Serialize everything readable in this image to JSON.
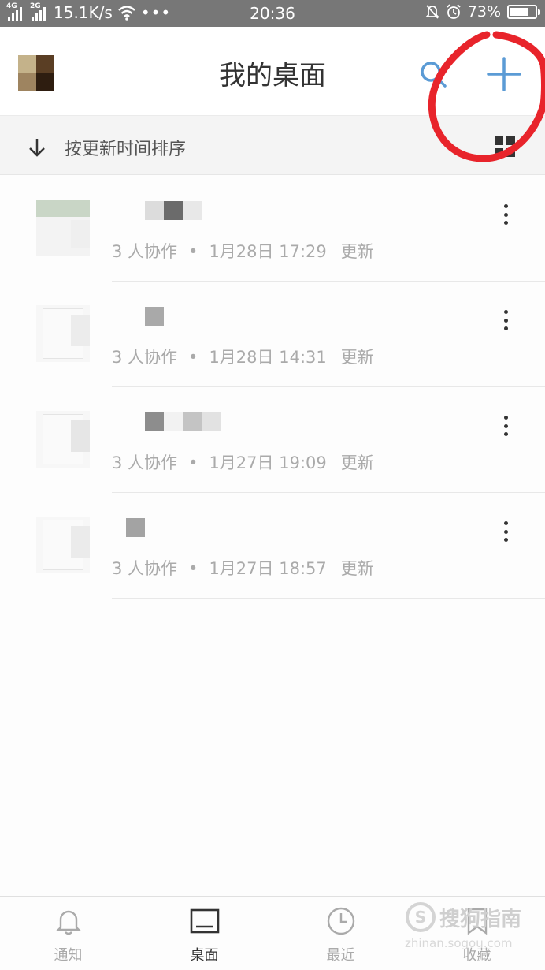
{
  "status_bar": {
    "network_1": "4G",
    "network_2": "2G",
    "speed": "15.1K/s",
    "time": "20:36",
    "battery_percent": "73%",
    "battery_level": 0.73
  },
  "header": {
    "title": "我的桌面"
  },
  "sort_bar": {
    "label": "按更新时间排序"
  },
  "files": [
    {
      "collaborators": "3 人协作",
      "date": "1月28日",
      "time": "17:29",
      "status": "更新"
    },
    {
      "collaborators": "3 人协作",
      "date": "1月28日",
      "time": "14:31",
      "status": "更新"
    },
    {
      "collaborators": "3 人协作",
      "date": "1月27日",
      "time": "19:09",
      "status": "更新"
    },
    {
      "collaborators": "3 人协作",
      "date": "1月27日",
      "time": "18:57",
      "status": "更新"
    }
  ],
  "tabs": [
    {
      "label": "通知",
      "icon": "bell-icon",
      "active": false
    },
    {
      "label": "桌面",
      "icon": "desktop-icon",
      "active": true
    },
    {
      "label": "最近",
      "icon": "clock-icon",
      "active": false
    },
    {
      "label": "收藏",
      "icon": "bookmark-icon",
      "active": false
    }
  ],
  "watermark": {
    "title": "搜狗指南",
    "url": "zhinan.sogou.com"
  },
  "colors": {
    "accent_blue": "#5b9bd5",
    "annotation_red": "#e8242b",
    "status_bar": "#777777"
  }
}
